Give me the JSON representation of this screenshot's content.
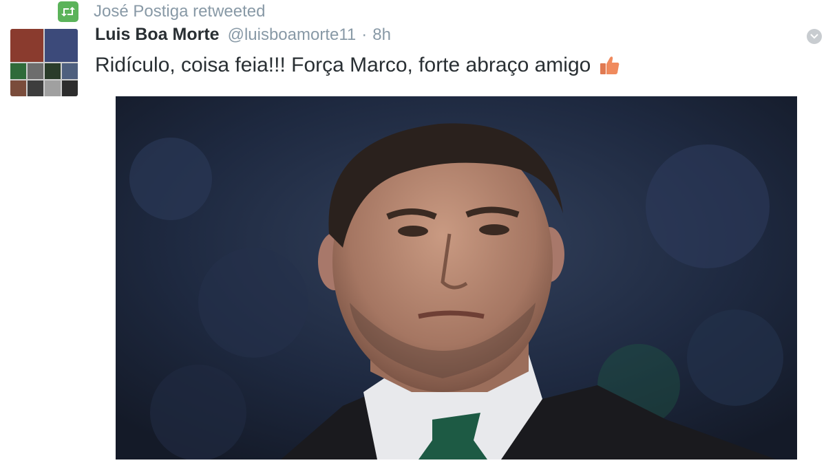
{
  "retweet": {
    "text": "José Postiga retweeted",
    "icon": "retweet-icon",
    "color": "#5bb35a"
  },
  "author": {
    "name": "Luis Boa Morte",
    "handle": "@luisboamorte11",
    "separator": "·",
    "time": "8h"
  },
  "tweet": {
    "text": "Ridículo, coisa feia!!! Força Marco, forte abraço amigo",
    "emoji": "thumbs-up-icon"
  },
  "media": {
    "type": "photo",
    "subject": "man-portrait"
  },
  "colors": {
    "name": "#292f33",
    "meta": "#8899a6",
    "text": "#292f33"
  }
}
